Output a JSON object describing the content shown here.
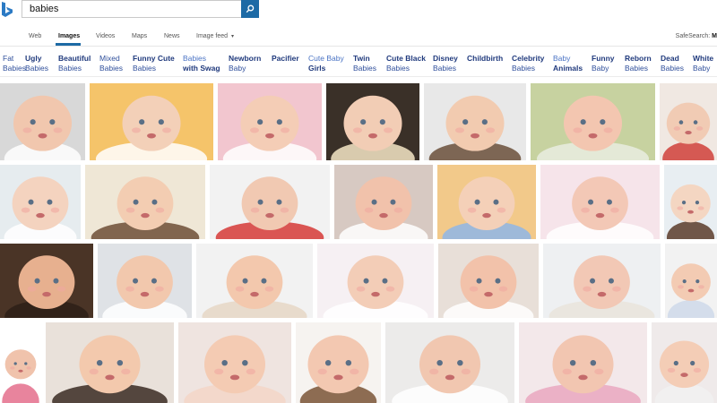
{
  "search": {
    "query": "babies"
  },
  "nav": {
    "items": [
      "Web",
      "Images",
      "Videos",
      "Maps",
      "News",
      "Image feed"
    ],
    "active": "Images",
    "safesearch_label": "SafeSearch:",
    "safesearch_value": "M"
  },
  "related": [
    {
      "line1": "Fat",
      "line2": "Babies"
    },
    {
      "line1": "Ugly",
      "line2": "Babies"
    },
    {
      "line1": "Beautiful",
      "line2": "Babies"
    },
    {
      "line1": "Mixed",
      "line2": "Babies"
    },
    {
      "line1": "Funny Cute",
      "line2": "Babies"
    },
    {
      "line1": "Babies",
      "line2": "with Swag"
    },
    {
      "line1": "Newborn",
      "line2": "Baby"
    },
    {
      "line1": "Pacifier",
      "line2": ""
    },
    {
      "line1": "Cute Baby",
      "line2": "Girls"
    },
    {
      "line1": "Twin",
      "line2": "Babies"
    },
    {
      "line1": "Cute Black",
      "line2": "Babies"
    },
    {
      "line1": "Disney",
      "line2": "Babies"
    },
    {
      "line1": "Childbirth",
      "line2": ""
    },
    {
      "line1": "Celebrity",
      "line2": "Babies"
    },
    {
      "line1": "Baby",
      "line2": "Animals"
    },
    {
      "line1": "Funny",
      "line2": "Baby"
    },
    {
      "line1": "Reborn",
      "line2": "Babies"
    },
    {
      "line1": "Dead",
      "line2": "Babies"
    },
    {
      "line1": "White",
      "line2": "Baby"
    }
  ],
  "colors": {
    "accent": "#1d6aa5",
    "chip_text": "#2f4f9b"
  },
  "images": [
    {
      "bg": "#d8d8d8",
      "skin": "#f1c7ae",
      "accent": "#ffffff"
    },
    {
      "bg": "#f5c46a",
      "skin": "#f3d0b8",
      "accent": "#ffffff"
    },
    {
      "bg": "#f2c6cf",
      "skin": "#f4cdb6",
      "accent": "#ffffff"
    },
    {
      "bg": "#3a3028",
      "skin": "#f2cdb5",
      "accent": "#f6e6c6"
    },
    {
      "bg": "#e8e8e8",
      "skin": "#f2cbb0",
      "accent": "#6a4f3a"
    },
    {
      "bg": "#c7d2a0",
      "skin": "#f3c6b0",
      "accent": "#e9ede0"
    },
    {
      "bg": "#f0e8e2",
      "skin": "#f1cbb4",
      "accent": "#d0403a"
    },
    {
      "bg": "#e6ecef",
      "skin": "#f4d3bf",
      "accent": "#ffffff"
    },
    {
      "bg": "#efe7d6",
      "skin": "#f3cdb2",
      "accent": "#6d4d36"
    },
    {
      "bg": "#f2f2f2",
      "skin": "#f1c9b2",
      "accent": "#d63a37"
    },
    {
      "bg": "#d7c9c2",
      "skin": "#f1c2ab",
      "accent": "#ffffff"
    },
    {
      "bg": "#f2c98a",
      "skin": "#f4d0b8",
      "accent": "#8fb6e6"
    },
    {
      "bg": "#f6e4ea",
      "skin": "#f3c8b6",
      "accent": "#ffffff"
    },
    {
      "bg": "#e8eef2",
      "skin": "#f4d6c2",
      "accent": "#5a3b2a"
    },
    {
      "bg": "#4a3426",
      "skin": "#e7b08f",
      "accent": "#2d2018"
    },
    {
      "bg": "#dfe2e6",
      "skin": "#f2c8ad",
      "accent": "#ffffff"
    },
    {
      "bg": "#f2f2f2",
      "skin": "#f3c8ad",
      "accent": "#e6d7c6"
    },
    {
      "bg": "#f6f0f3",
      "skin": "#f3cdb7",
      "accent": "#ffffff"
    },
    {
      "bg": "#e8dfd8",
      "skin": "#f2c2aa",
      "accent": "#ffffff"
    },
    {
      "bg": "#eef0f2",
      "skin": "#f2c8b5",
      "accent": "#e9e4dc"
    },
    {
      "bg": "#f2f2f2",
      "skin": "#f3cbb3",
      "accent": "#cfd9ea"
    },
    {
      "bg": "#ffffff",
      "skin": "#f0c3ac",
      "accent": "#e46f8c"
    },
    {
      "bg": "#e9e1da",
      "skin": "#f3c9ad",
      "accent": "#3a2a22"
    },
    {
      "bg": "#efe4e0",
      "skin": "#f4cbb3",
      "accent": "#f3d6c7"
    },
    {
      "bg": "#f6f3f0",
      "skin": "#f3c8b1",
      "accent": "#7a5436"
    },
    {
      "bg": "#ecebea",
      "skin": "#f1c7b0",
      "accent": "#ffffff"
    },
    {
      "bg": "#f3e8ea",
      "skin": "#f2c6b1",
      "accent": "#e9a7c0"
    },
    {
      "bg": "#efeaea",
      "skin": "#f4cdb6",
      "accent": "#f1f1f1"
    }
  ]
}
